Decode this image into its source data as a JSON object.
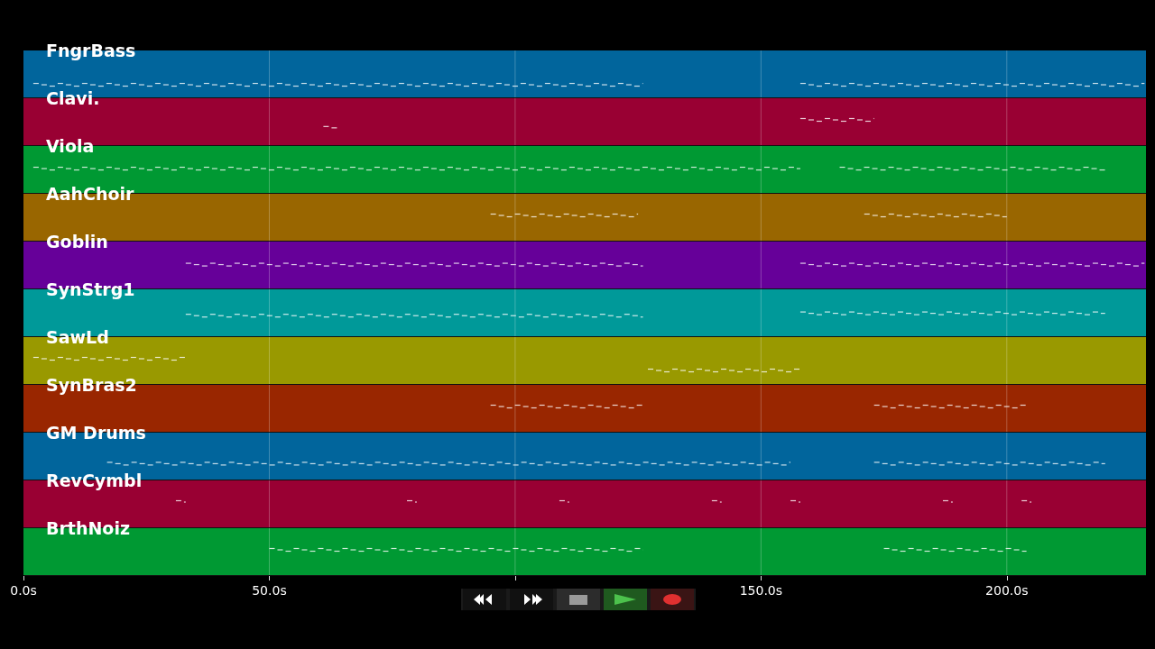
{
  "tracks": [
    {
      "name": "FngrBass",
      "color": "#01659c"
    },
    {
      "name": "Clavi.",
      "color": "#990033"
    },
    {
      "name": "Viola",
      "color": "#009933"
    },
    {
      "name": "AahChoir",
      "color": "#996600"
    },
    {
      "name": "Goblin",
      "color": "#660099"
    },
    {
      "name": "SynStrg1",
      "color": "#009999"
    },
    {
      "name": "SawLd",
      "color": "#999900"
    },
    {
      "name": "SynBras2",
      "color": "#992600"
    },
    {
      "name": "GM Drums",
      "color": "#01659c"
    },
    {
      "name": "RevCymbl",
      "color": "#990033"
    },
    {
      "name": "BrthNoiz",
      "color": "#009933"
    }
  ],
  "time_axis": {
    "tick_labels": [
      "0.0s",
      "50.0s",
      "150.0s",
      "200.0s"
    ]
  },
  "transport": {
    "buttons": [
      {
        "kind": "rewind"
      },
      {
        "kind": "forward"
      },
      {
        "kind": "stop"
      },
      {
        "kind": "play"
      },
      {
        "kind": "record"
      }
    ]
  }
}
